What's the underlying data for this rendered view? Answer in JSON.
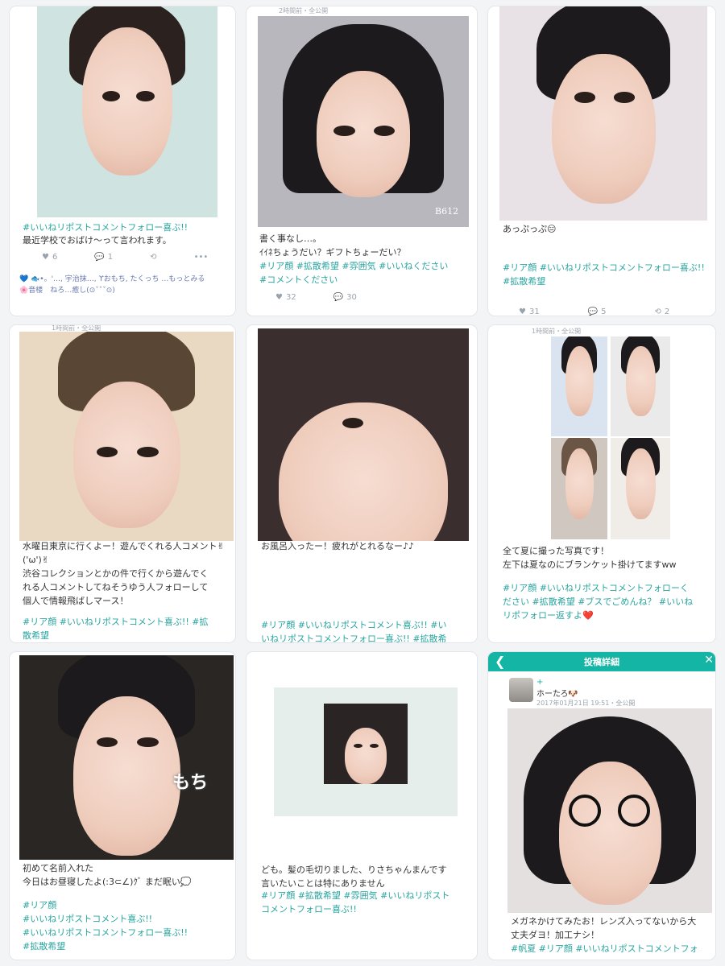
{
  "tiles": [
    {
      "caption_tag_top": "#いいねリポストコメントフォロー喜ぶ!!",
      "caption": "最近学校でおばけ〜って言われます。",
      "likes": "6",
      "comments": "1",
      "like_line1": "💙 🐟•。'…, 宇治抹…, ϒおもち, たくっち …もっとみる",
      "like_line2": "🌸音楼　ねろ…癒し(⊙ˇˇˇ⊙)"
    },
    {
      "top_meta": "2時間前・全公開",
      "caption": "書く事なし…。\nｲｲﾈちょうだい？ギフトちょーだい？",
      "tags": "#リア顔 #拡散希望 #雰囲気 #いいねください\n#コメントください",
      "likes": "32",
      "comments": "30",
      "watermark": "B612"
    },
    {
      "caption": "あっぷっぷ😑",
      "tags": "#リア顔 #いいねリポストコメントフォロー喜ぶ!!\n#拡散希望",
      "likes": "31",
      "comments": "5",
      "reposts": "2"
    },
    {
      "top_meta": "1時間前・全公開",
      "caption": "水曜日東京に行くよー！遊んでくれる人コメント✌('ω')✌\n渋谷コレクションとかの件で行くから遊んでく\nれる人コメントしてねそうゆう人フォローして\n個人で情報飛ばしマース！",
      "tags": "#リア顔 #いいねリポストコメント喜ぶ!! #拡\n散希望"
    },
    {
      "caption": "お風呂入ったー！疲れがとれるなー♪♪",
      "tags": "#リア顔 #いいねリポストコメント喜ぶ!! #い\nいねリポストコメントフォロー喜ぶ!! #拡散希"
    },
    {
      "top_meta": "1時間前・全公開",
      "caption": "全て夏に撮った写真です！\n左下は夏なのにブランケット掛けてますww",
      "tags": "#リア顔 #いいねリポストコメントフォローく\nださい #拡散希望 #ブスでごめんね？ #いいね\nリポフォロー返すよ❤️"
    },
    {
      "caption": "初めて名前入れた\n今日はお昼寝したよ(:3⊂∠)ｸﾞ まだ眠い💭",
      "tags": "#リア顔\n#いいねリポストコメント喜ぶ!!\n#いいねリポストコメントフォロー喜ぶ!!\n#拡散希望",
      "sticker": "もち"
    },
    {
      "caption": "ども。髪の毛切りました、りさちゃんまんです\n言いたいことは特にありません",
      "tags": "#リア顔 #拡散希望 #雰囲気 #いいねリポスト\nコメントフォロー喜ぶ!!"
    },
    {
      "nav_title": "投稿詳細",
      "username": "ホーたろ🐶",
      "date": "2017年01月21日 19:51・全公開",
      "caption": "メガネかけてみたお！レンズ入ってないから大\n丈夫ダヨ！加工ナシ！",
      "tags": "#帆夏 #リア顔 #いいねリポストコメントフォ"
    }
  ]
}
